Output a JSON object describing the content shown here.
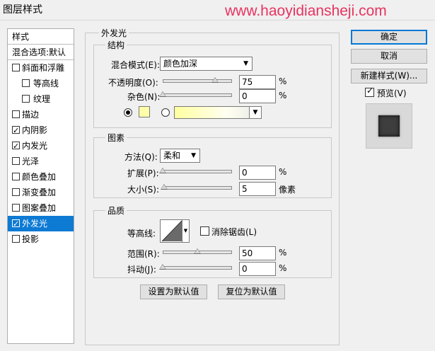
{
  "window": {
    "title": "图层样式"
  },
  "watermark": "www.haoyidiansheji.com",
  "left_list": {
    "header": "样式",
    "blend_default": "混合选项:默认",
    "items": [
      {
        "label": "斜面和浮雕",
        "checked": false,
        "sub": false
      },
      {
        "label": "等高线",
        "checked": false,
        "sub": true
      },
      {
        "label": "纹理",
        "checked": false,
        "sub": true
      },
      {
        "label": "描边",
        "checked": false,
        "sub": false
      },
      {
        "label": "内阴影",
        "checked": true,
        "sub": false
      },
      {
        "label": "内发光",
        "checked": true,
        "sub": false
      },
      {
        "label": "光泽",
        "checked": false,
        "sub": false
      },
      {
        "label": "颜色叠加",
        "checked": false,
        "sub": false
      },
      {
        "label": "渐变叠加",
        "checked": false,
        "sub": false
      },
      {
        "label": "图案叠加",
        "checked": false,
        "sub": false
      },
      {
        "label": "外发光",
        "checked": true,
        "sub": false,
        "selected": true
      },
      {
        "label": "投影",
        "checked": false,
        "sub": false
      }
    ]
  },
  "panel": {
    "title": "外发光",
    "structure": {
      "title": "结构",
      "blend_mode_label": "混合模式(E):",
      "blend_mode_value": "颜色加深",
      "opacity_label": "不透明度(O):",
      "opacity_value": "75",
      "opacity_level": 0.75,
      "noise_label": "杂色(N):",
      "noise_value": "0",
      "noise_level": 0,
      "pct": "%",
      "glow_color": "#ffffaa"
    },
    "elements": {
      "title": "图素",
      "technique_label": "方法(Q):",
      "technique_value": "柔和",
      "spread_label": "扩展(P):",
      "spread_value": "0",
      "spread_level": 0,
      "size_label": "大小(S):",
      "size_value": "5",
      "size_level": 0.02,
      "size_unit": "像素",
      "pct": "%"
    },
    "quality": {
      "title": "品质",
      "contour_label": "等高线:",
      "antialias_label": "消除锯齿(L)",
      "antialias_checked": false,
      "range_label": "范围(R):",
      "range_value": "50",
      "range_level": 0.5,
      "jitter_label": "抖动(J):",
      "jitter_value": "0",
      "jitter_level": 0,
      "pct": "%"
    },
    "make_default": "设置为默认值",
    "reset_default": "复位为默认值"
  },
  "right": {
    "ok": "确定",
    "cancel": "取消",
    "new_style": "新建样式(W)...",
    "preview_label": "预览(V)",
    "preview_checked": true
  }
}
